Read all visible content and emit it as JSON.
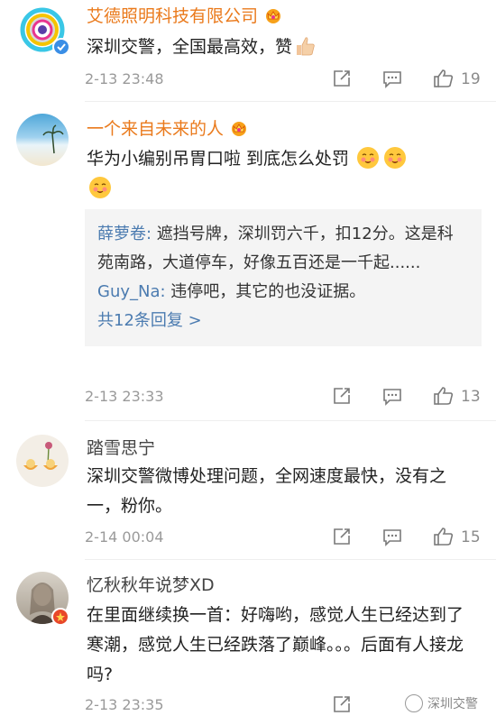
{
  "comments": [
    {
      "username": "艾德照明科技有限公司",
      "text": "深圳交警，全国最高效，赞",
      "time": "2-13 23:48",
      "likes": "19",
      "verified": true
    },
    {
      "username": "一个来自未来的人",
      "text": "华为小编别吊胃口啦 到底怎么处罚",
      "time": "2-13 23:33",
      "likes": "13",
      "replies": [
        {
          "name": "薛萝卷:",
          "text": " 遮挡号牌，深圳罚六千，扣12分。这是科苑南路，大道停车，好像五百还是一千起......"
        },
        {
          "name": "Guy_Na:",
          "text": " 违停吧，其它的也没证据。"
        }
      ],
      "more_replies": "共12条回复 >"
    },
    {
      "username": "踏雪思宁",
      "text": "深圳交警微博处理问题，全网速度最快，没有之一，粉你。",
      "time": "2-14 00:04",
      "likes": "15"
    },
    {
      "username": "忆秋秋年说梦XD",
      "text": "在里面继续换一首：好嗨哟，感觉人生已经达到了寒潮，感觉人生已经跌落了巅峰。。。后面有人接龙吗?",
      "time": "2-13 23:35",
      "likes": ""
    }
  ],
  "watermark": "深圳交警",
  "colors": {
    "vip_name": "#ea7a1c",
    "link": "#4b7bb0",
    "meta": "#9a9a9a",
    "reply_bg": "#f4f4f4"
  },
  "icons": [
    "share-icon",
    "comment-icon",
    "like-icon",
    "vip-crown-icon",
    "verified-badge-icon"
  ]
}
